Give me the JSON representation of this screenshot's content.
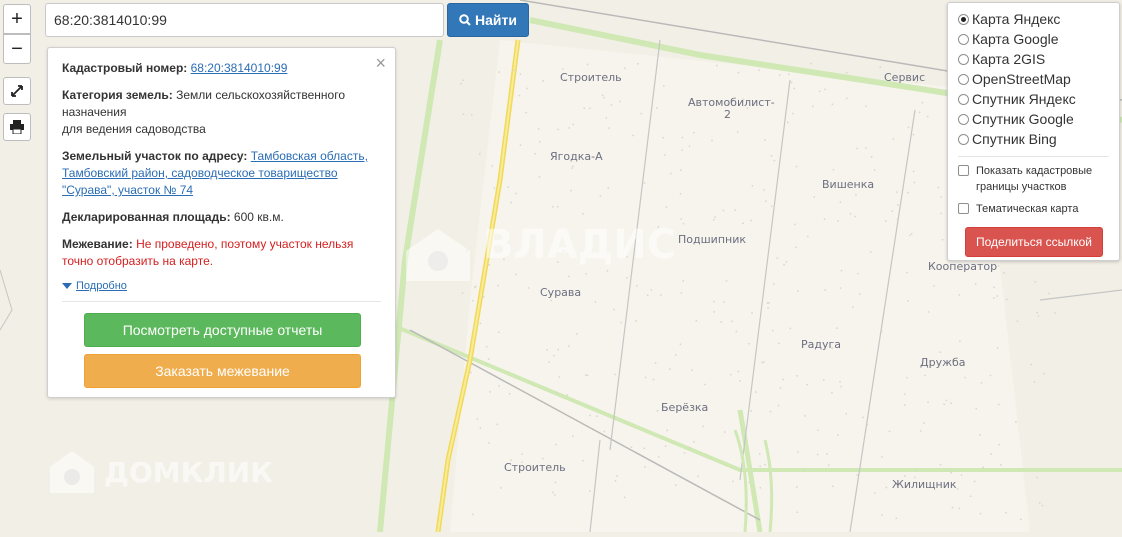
{
  "search": {
    "value": "68:20:3814010:99",
    "button_label": "Найти"
  },
  "zoom": {
    "in": "+",
    "out": "−"
  },
  "info": {
    "cadastral_label": "Кадастровый номер:",
    "cadastral_value": "68:20:3814010:99",
    "category_label": "Категория земель:",
    "category_value_1": "Земли сельскохозяйственного",
    "category_value_2": "назначения",
    "category_value_3": "для ведения садоводства",
    "address_label": "Земельный участок по адресу:",
    "address_value_1": "Тамбовская область,",
    "address_value_2": "Тамбовский район, садоводческое товарищество",
    "address_value_3": "\"Сурава\", участок № 74",
    "area_label": "Декларированная площадь:",
    "area_value": "600 кв.м.",
    "survey_label": "Межевание:",
    "survey_value_1": "Не проведено, поэтому участок нельзя",
    "survey_value_2": "точно отобразить на карте.",
    "more_link": "Подробно",
    "reports_button": "Посмотреть доступные отчеты",
    "order_survey_button": "Заказать межевание",
    "close": "×"
  },
  "layers": {
    "options": [
      {
        "label": "Карта Яндекс",
        "selected": true
      },
      {
        "label": "Карта Google",
        "selected": false
      },
      {
        "label": "Карта 2GIS",
        "selected": false
      },
      {
        "label": "OpenStreetMap",
        "selected": false
      },
      {
        "label": "Спутник Яндекс",
        "selected": false
      },
      {
        "label": "Спутник Google",
        "selected": false
      },
      {
        "label": "Спутник Bing",
        "selected": false
      }
    ],
    "show_borders_1": "Показать кадастровые",
    "show_borders_2": "границы участков",
    "thematic_map": "Тематическая карта",
    "share_button": "Поделиться ссылкой"
  },
  "map_labels": {
    "stroitel_top": "Строитель",
    "avtomobilist_1": "Автомобилист-",
    "avtomobilist_2": "2",
    "servis": "Сервис",
    "yagodka": "Ягодка-А",
    "vishenka": "Вишенка",
    "podshipnik": "Подшипник",
    "kooperator": "Кооператор",
    "surava": "Сурава",
    "raduga": "Радуга",
    "druzhba": "Дружба",
    "berezka": "Берёзка",
    "stroitel_bottom": "Строитель",
    "zhilishnik": "Жилищник"
  },
  "watermarks": {
    "vladis": "ВЛАДИС",
    "domclick": "ДОМКЛИК"
  },
  "colors": {
    "primary": "#3277b8",
    "success": "#5cb85c",
    "warning": "#f0ad4e",
    "danger": "#d9534f",
    "road": "#f5e36d",
    "greenbelt": "#cfe8b4"
  }
}
